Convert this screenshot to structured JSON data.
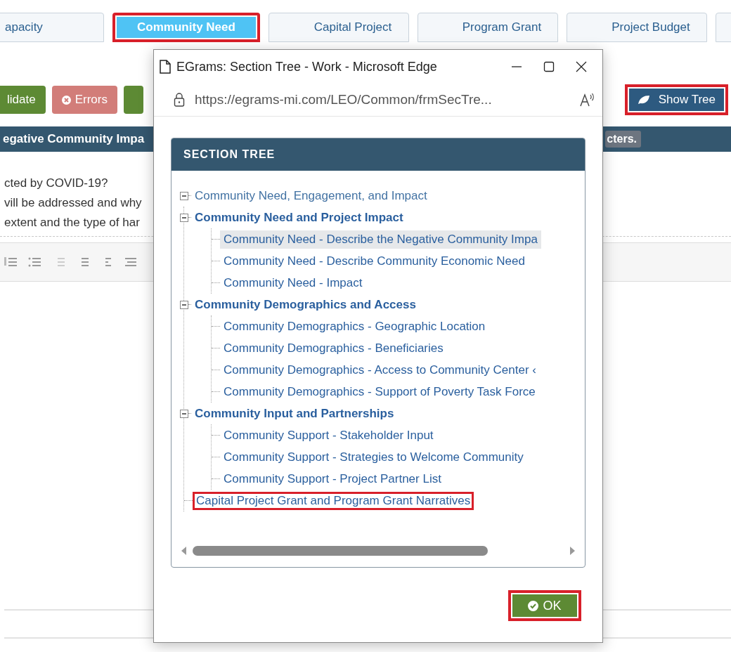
{
  "tabs": [
    {
      "label": "apacity",
      "selected": false,
      "highlighted": false
    },
    {
      "label": "Community Need",
      "selected": true,
      "highlighted": true
    },
    {
      "label": "Capital Project",
      "selected": false,
      "highlighted": false
    },
    {
      "label": "Program Grant",
      "selected": false,
      "highlighted": false
    },
    {
      "label": "Project Budget",
      "selected": false,
      "highlighted": false
    },
    {
      "selected": false,
      "highlighted": false
    }
  ],
  "action_buttons": [
    {
      "kind": "success",
      "label": "lidate"
    },
    {
      "kind": "danger",
      "label": "Errors"
    },
    {
      "kind": "success"
    }
  ],
  "show_tree_button": {
    "label": "Show Tree",
    "highlighted": true
  },
  "section_bar": {
    "title": "egative Community Impa",
    "badge": "cters."
  },
  "question_lines": [
    "cted by COVID-19?",
    "vill be addressed and why",
    "extent and the type of har"
  ],
  "popup": {
    "title": "EGrams: Section Tree - Work - Microsoft Edge",
    "url": "https://egrams-mi.com/LEO/Common/frmSecTre...",
    "panel_title": "SECTION TREE",
    "tree": [
      {
        "kind": "root",
        "label": "Community Need, Engagement, and Impact",
        "expanded": true,
        "selected": false,
        "highlighted": false,
        "children": [
          {
            "kind": "group",
            "label": "Community Need and Project Impact",
            "expanded": true,
            "selected": false,
            "highlighted": false,
            "children": [
              {
                "kind": "page",
                "label": "Community Need - Describe the Negative Community Impa",
                "selected": true,
                "highlighted": false
              },
              {
                "kind": "page",
                "label": "Community Need - Describe Community Economic Need",
                "selected": false,
                "highlighted": false
              },
              {
                "kind": "page",
                "label": "Community Need - Impact",
                "selected": false,
                "highlighted": false
              }
            ]
          },
          {
            "kind": "group",
            "label": "Community Demographics and Access",
            "expanded": true,
            "selected": false,
            "highlighted": false,
            "children": [
              {
                "kind": "page",
                "label": "Community Demographics - Geographic Location",
                "selected": false,
                "highlighted": false
              },
              {
                "kind": "page",
                "label": "Community Demographics - Beneficiaries",
                "selected": false,
                "highlighted": false
              },
              {
                "kind": "page",
                "label": "Community Demographics - Access to Community Center ‹",
                "selected": false,
                "highlighted": false
              },
              {
                "kind": "page",
                "label": "Community Demographics - Support of Poverty Task Force",
                "selected": false,
                "highlighted": false
              }
            ]
          },
          {
            "kind": "group",
            "label": "Community Input and Partnerships",
            "expanded": true,
            "selected": false,
            "highlighted": false,
            "children": [
              {
                "kind": "page",
                "label": "Community Support - Stakeholder Input",
                "selected": false,
                "highlighted": false
              },
              {
                "kind": "page",
                "label": "Community Support - Strategies to Welcome Community",
                "selected": false,
                "highlighted": false
              },
              {
                "kind": "page",
                "label": "Community Support - Project Partner List",
                "selected": false,
                "highlighted": false
              }
            ]
          },
          {
            "kind": "page",
            "label": "Capital Project Grant and Program Grant Narratives",
            "selected": false,
            "highlighted": true
          }
        ]
      }
    ],
    "ok_button": {
      "label": "OK",
      "highlighted": true
    }
  }
}
